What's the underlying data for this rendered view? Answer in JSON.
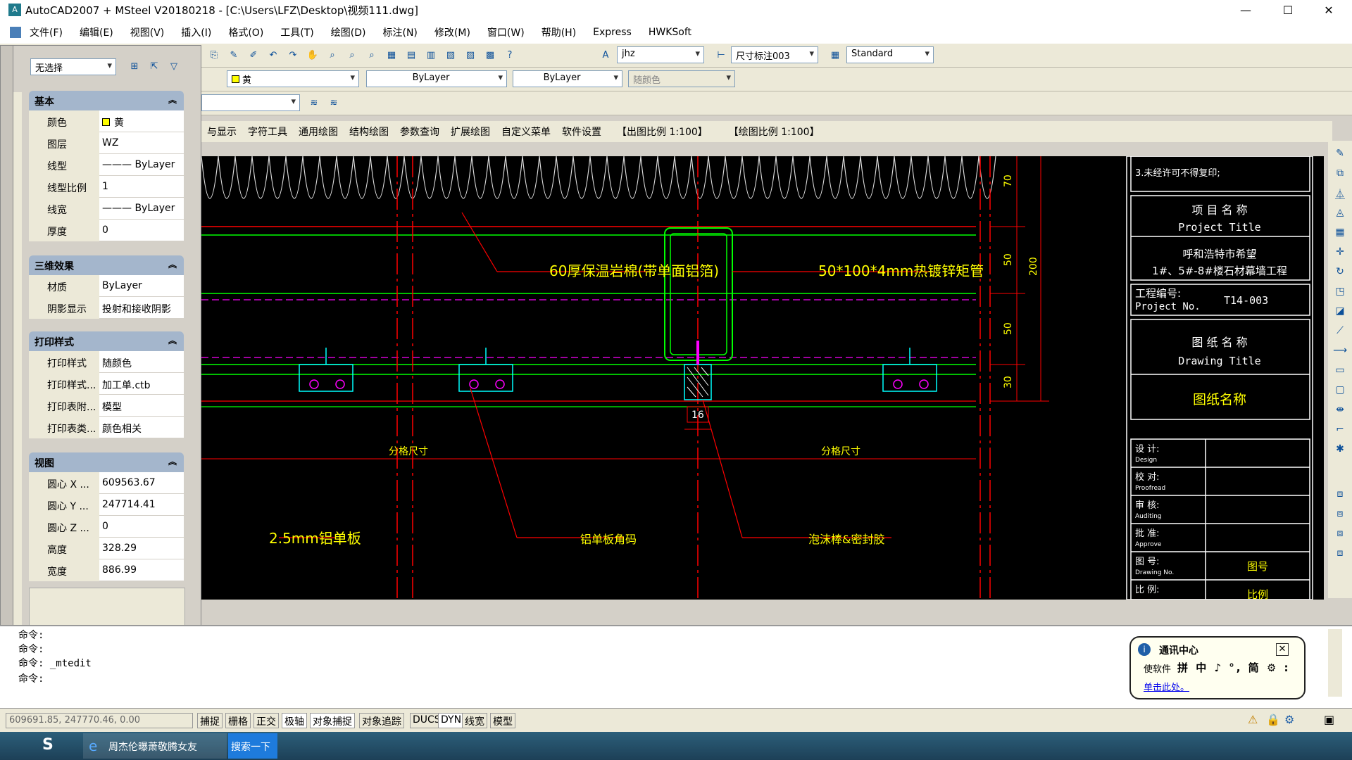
{
  "window": {
    "title": "AutoCAD2007 + MSteel V20180218 - [C:\\Users\\LFZ\\Desktop\\视频111.dwg]",
    "minimize": "—",
    "maximize": "☐",
    "close": "✕"
  },
  "menubar": {
    "items": [
      "文件(F)",
      "编辑(E)",
      "视图(V)",
      "插入(I)",
      "格式(O)",
      "工具(T)",
      "绘图(D)",
      "标注(N)",
      "修改(M)",
      "窗口(W)",
      "帮助(H)",
      "Express",
      "HWKSoft"
    ]
  },
  "toolbar": {
    "text_style": "jhz",
    "dim_style": "尺寸标注003",
    "table_style": "Standard",
    "color": "黄",
    "linetype": "ByLayer",
    "lineweight": "ByLayer",
    "plotstyle": "随颜色"
  },
  "drawmenu": {
    "items": [
      "与显示",
      "字符工具",
      "通用绘图",
      "结构绘图",
      "参数查询",
      "扩展绘图",
      "自定义菜单",
      "软件设置",
      "【出图比例 1:100】",
      "【绘图比例 1:100】"
    ]
  },
  "props": {
    "selection": "无选择",
    "sections": {
      "basic": "基本",
      "threed": "三维效果",
      "print": "打印样式",
      "view": "视图"
    },
    "basic": [
      {
        "k": "颜色",
        "v": "黄"
      },
      {
        "k": "图层",
        "v": "WZ"
      },
      {
        "k": "线型",
        "v": "——— ByLayer"
      },
      {
        "k": "线型比例",
        "v": "1"
      },
      {
        "k": "线宽",
        "v": "——— ByLayer"
      },
      {
        "k": "厚度",
        "v": "0"
      }
    ],
    "threed": [
      {
        "k": "材质",
        "v": "ByLayer"
      },
      {
        "k": "阴影显示",
        "v": "投射和接收阴影"
      }
    ],
    "print": [
      {
        "k": "打印样式",
        "v": "随颜色"
      },
      {
        "k": "打印样式...",
        "v": "加工单.ctb"
      },
      {
        "k": "打印表附...",
        "v": "模型"
      },
      {
        "k": "打印表类...",
        "v": "颜色相关"
      }
    ],
    "view": [
      {
        "k": "圆心 X ...",
        "v": "609563.67"
      },
      {
        "k": "圆心 Y ...",
        "v": "247714.41"
      },
      {
        "k": "圆心 Z ...",
        "v": "0"
      },
      {
        "k": "高度",
        "v": "328.29"
      },
      {
        "k": "宽度",
        "v": "886.99"
      }
    ]
  },
  "drawing": {
    "labels": {
      "insulation": "60厚保温岩棉(带单面铝箔)",
      "tube": "50*100*4mm热镀锌矩管",
      "panel": "2.5mm铝单板",
      "corner": "铝单板角码",
      "sealant": "泡沫棒&密封胶",
      "grid_a": "分格尺寸",
      "grid_b": "分格尺寸",
      "d16": "16",
      "d70": "70",
      "d50a": "50",
      "d50b": "50",
      "d30": "30",
      "d200": "200"
    },
    "titleblock": {
      "note": "3.未经许可不得复印;",
      "project_cn": "项 目 名 称",
      "project_en": "Project Title",
      "project_name1": "呼和浩特市希望",
      "project_name2": "1#、5#-8#楼石材幕墙工程",
      "projno_cn": "工程编号:",
      "projno_en": "Project No.",
      "projno": "T14-003",
      "dtitle_cn": "图 纸 名 称",
      "dtitle_en": "Drawing Title",
      "dname": "图纸名称",
      "design": "设 计:",
      "design_en": "Design",
      "proof": "校 对:",
      "proof_en": "Proofread",
      "audit": "审 核:",
      "audit_en": "Auditing",
      "approve": "批 准:",
      "approve_en": "Approve",
      "dwgno": "图 号:",
      "dwgno_en": "Drawing No.",
      "dwgno_val": "图号",
      "scale": "比 例:",
      "scale_val": "比例"
    }
  },
  "command": {
    "lines": [
      "命令:",
      "命令:",
      "命令: _mtedit",
      "命令:"
    ]
  },
  "status": {
    "coords": "609691.85, 247770.46, 0.00",
    "buttons": [
      "捕捉",
      "栅格",
      "正交",
      "极轴",
      "对象捕捉",
      "对象追踪",
      "DUCS",
      "DYN",
      "线宽",
      "模型"
    ]
  },
  "balloon": {
    "title": "通讯中心",
    "ime_label": "使软件",
    "ime_icons": "拼 中 ♪ °, 简 ⚙ :",
    "link": "单击此处。"
  },
  "taskbar": {
    "app": "周杰伦曝萧敬腾女友",
    "search": "搜索一下"
  },
  "colors": {
    "canvas": "#000000",
    "yellow": "#ffff00",
    "green": "#00ff00",
    "cyan": "#00ffff",
    "red": "#ff0000",
    "magenta": "#ff00ff",
    "white": "#ffffff",
    "section": "#a4b6cc"
  }
}
